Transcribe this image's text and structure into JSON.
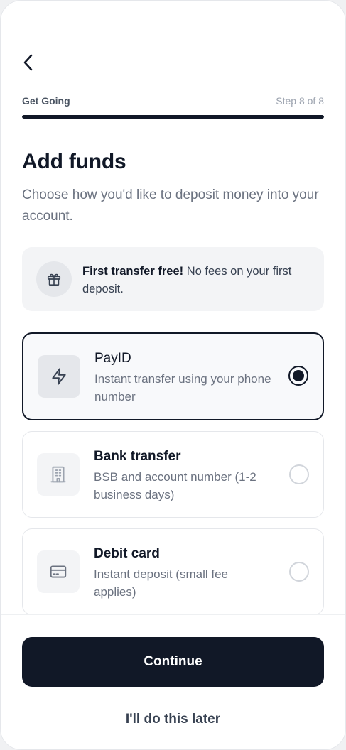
{
  "header": {
    "back_icon": "chevron-left-icon",
    "progress_label": "Get Going",
    "step_text": "Step 8 of 8",
    "progress_fraction": 1.0
  },
  "main": {
    "title": "Add funds",
    "subtitle": "Choose how you'd like to deposit money into your account."
  },
  "promo": {
    "icon": "gift-icon",
    "bold": "First transfer free!",
    "text": " No fees on your first deposit."
  },
  "options": [
    {
      "icon": "lightning-icon",
      "title": "PayID",
      "description": "Instant transfer using your phone number",
      "selected": true
    },
    {
      "icon": "building-icon",
      "title": "Bank transfer",
      "description": "BSB and account number (1-2 business days)",
      "selected": false
    },
    {
      "icon": "credit-card-icon",
      "title": "Debit card",
      "description": "Instant deposit (small fee applies)",
      "selected": false
    }
  ],
  "footer": {
    "continue_label": "Continue",
    "later_label": "I'll do this later"
  },
  "colors": {
    "primary": "#111827",
    "muted_text": "#6b7280",
    "surface": "#f3f4f6"
  }
}
